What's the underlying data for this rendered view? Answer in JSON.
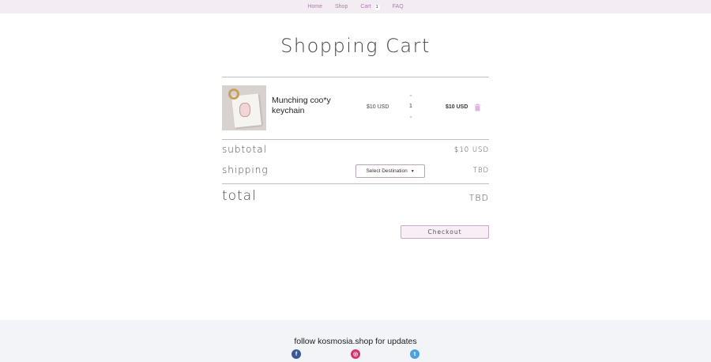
{
  "nav": {
    "items": [
      {
        "label": "Home"
      },
      {
        "label": "Shop"
      },
      {
        "label": "Cart",
        "count": "1"
      },
      {
        "label": "FAQ"
      }
    ]
  },
  "page": {
    "title": "Shopping Cart"
  },
  "cart": {
    "items": [
      {
        "name": "Munching coo*y keychain",
        "price": "$10 USD",
        "quantity": "1",
        "total": "$10 USD",
        "remove_icon": "trash-icon"
      }
    ]
  },
  "summary": {
    "subtotal_label": "subtotal",
    "subtotal_value": "$10 USD",
    "shipping_label": "shipping",
    "shipping_select": "Select Destination",
    "shipping_value": "TBD",
    "total_label": "total",
    "total_value": "TBD"
  },
  "checkout": {
    "label": "Checkout"
  },
  "footer": {
    "text": "follow kosmosia.shop for updates",
    "social": [
      {
        "icon": "facebook-icon",
        "glyph": "f",
        "color": "#3b5998"
      },
      {
        "icon": "instagram-icon",
        "glyph": "◎",
        "color": "#d6336c"
      },
      {
        "icon": "twitter-icon",
        "glyph": "t",
        "color": "#4aa3df"
      }
    ]
  },
  "colors": {
    "nav_bg": "#f4ecf3",
    "nav_link": "#b07ab3",
    "checkout_bg": "#f7eef6",
    "footer_bg": "#f2f4f7"
  }
}
